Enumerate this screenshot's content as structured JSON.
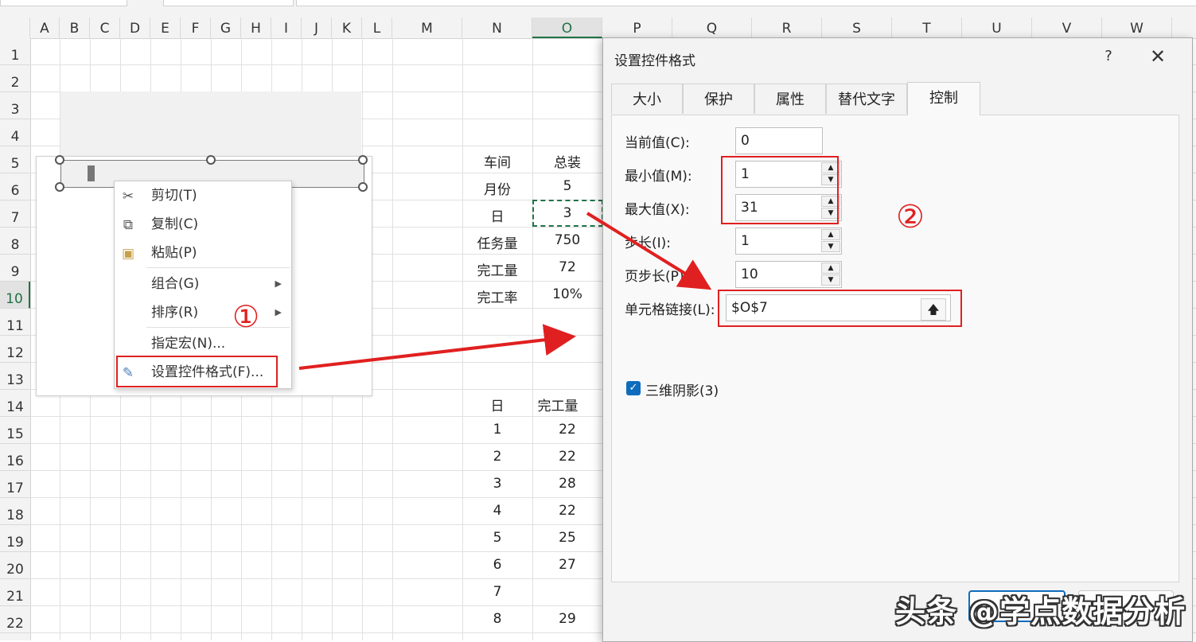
{
  "columns": [
    "A",
    "B",
    "C",
    "D",
    "E",
    "F",
    "G",
    "H",
    "I",
    "J",
    "K",
    "L",
    "M",
    "N",
    "O",
    "P",
    "Q",
    "R",
    "S",
    "T",
    "U",
    "V",
    "W"
  ],
  "selected_column": "O",
  "rows": [
    "1",
    "2",
    "3",
    "4",
    "5",
    "6",
    "7",
    "8",
    "9",
    "10",
    "11",
    "12",
    "13",
    "14",
    "15",
    "16",
    "17",
    "18",
    "19",
    "20",
    "21",
    "22"
  ],
  "selected_row": "10",
  "summary_table": {
    "rows": [
      {
        "label": "车间",
        "value": "总装"
      },
      {
        "label": "月份",
        "value": "5"
      },
      {
        "label": "日",
        "value": "3"
      },
      {
        "label": "任务量",
        "value": "750"
      },
      {
        "label": "完工量",
        "value": "72"
      },
      {
        "label": "完工率",
        "value": "10%"
      }
    ]
  },
  "daily_table": {
    "header": {
      "day": "日",
      "done": "完工量"
    },
    "rows": [
      {
        "day": "1",
        "done": "22"
      },
      {
        "day": "2",
        "done": "22"
      },
      {
        "day": "3",
        "done": "28"
      },
      {
        "day": "4",
        "done": "22"
      },
      {
        "day": "5",
        "done": "25"
      },
      {
        "day": "6",
        "done": "27"
      },
      {
        "day": "7",
        "done": ""
      },
      {
        "day": "8",
        "done": "29"
      }
    ]
  },
  "context_menu": {
    "items": [
      {
        "label": "剪切(T)",
        "icon": "scissors-icon"
      },
      {
        "label": "复制(C)",
        "icon": "copy-icon"
      },
      {
        "label": "粘贴(P)",
        "icon": "paste-icon"
      },
      {
        "label": "组合(G)",
        "submenu": true
      },
      {
        "label": "排序(R)",
        "submenu": true
      },
      {
        "label": "指定宏(N)..."
      },
      {
        "label": "设置控件格式(F)...",
        "icon": "format-control-icon"
      }
    ]
  },
  "annotations": {
    "step1": "①",
    "step2": "②",
    "accent": "#e02020"
  },
  "dialog": {
    "title": "设置控件格式",
    "help": "?",
    "close": "✕",
    "tabs": [
      "大小",
      "保护",
      "属性",
      "替代文字",
      "控制"
    ],
    "active_tab": "控制",
    "fields": {
      "current_value": {
        "label": "当前值(C):",
        "value": "0"
      },
      "min_value": {
        "label": "最小值(M):",
        "value": "1"
      },
      "max_value": {
        "label": "最大值(X):",
        "value": "31"
      },
      "step": {
        "label": "步长(I):",
        "value": "1"
      },
      "page_step": {
        "label": "页步长(P):",
        "value": "10"
      },
      "cell_link": {
        "label": "单元格链接(L):",
        "value": "$O$7"
      }
    },
    "shading_3d": {
      "label": "三维阴影(3)",
      "checked": true
    }
  },
  "watermark": "头条 @学点数据分析"
}
